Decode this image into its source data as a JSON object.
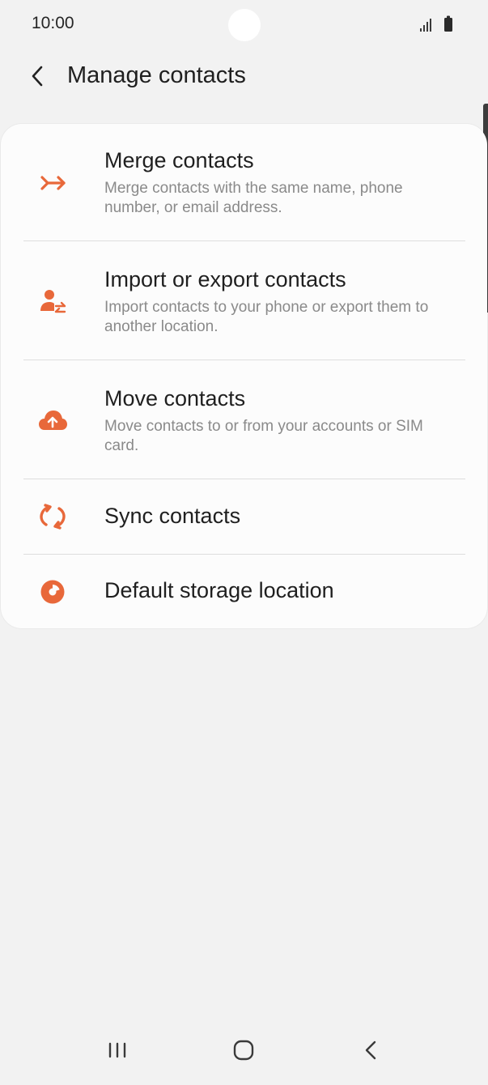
{
  "status_bar": {
    "time": "10:00"
  },
  "header": {
    "title": "Manage contacts"
  },
  "menu": {
    "items": [
      {
        "title": "Merge contacts",
        "description": "Merge contacts with the same name, phone number, or email address.",
        "icon": "merge-icon"
      },
      {
        "title": "Import or export contacts",
        "description": "Import contacts to your phone or export them to another location.",
        "icon": "import-export-icon"
      },
      {
        "title": "Move contacts",
        "description": "Move contacts to or from your accounts or SIM card.",
        "icon": "cloud-upload-icon"
      },
      {
        "title": "Sync contacts",
        "description": "",
        "icon": "sync-icon"
      },
      {
        "title": "Default storage location",
        "description": "",
        "icon": "storage-location-icon"
      }
    ]
  },
  "colors": {
    "accent": "#e8683a",
    "background": "#f2f2f2",
    "card": "#fcfcfc"
  }
}
